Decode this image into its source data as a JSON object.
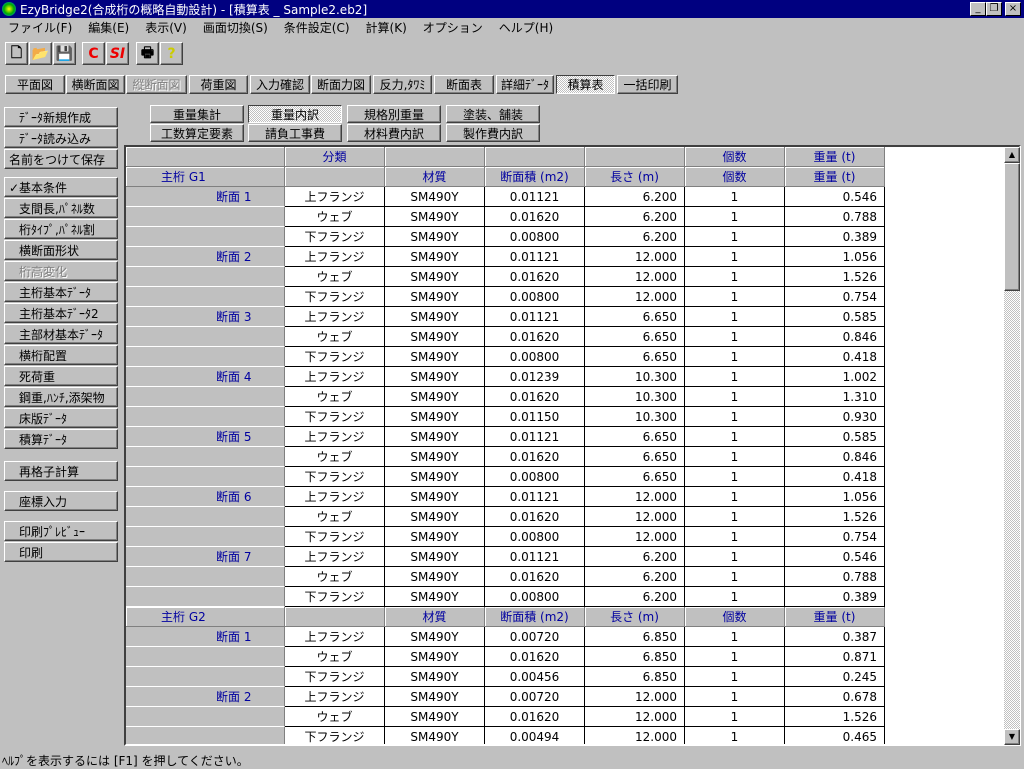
{
  "window": {
    "title": "EzyBridge2(合成桁の概略自動設計) - [積算表 _ Sample2.eb2]",
    "min": "_",
    "max": "❐",
    "close": "×"
  },
  "menu": [
    "ファイル(F)",
    "編集(E)",
    "表示(V)",
    "画面切換(S)",
    "条件設定(C)",
    "計算(K)",
    "オプション",
    "ヘルプ(H)"
  ],
  "toolbar": {
    "new": "🗋",
    "open": "📂",
    "save": "💾",
    "c": "C",
    "si": "SI",
    "print": "🖶",
    "help": "?"
  },
  "tabs": [
    {
      "label": "平面図"
    },
    {
      "label": "横断面図"
    },
    {
      "label": "縦断面図",
      "disabled": true
    },
    {
      "label": "荷重図"
    },
    {
      "label": "入力確認"
    },
    {
      "label": "断面力図"
    },
    {
      "label": "反力,ﾀﾜﾐ"
    },
    {
      "label": "断面表"
    },
    {
      "label": "詳細ﾃﾞｰﾀ"
    },
    {
      "label": "積算表",
      "active": true
    },
    {
      "label": "一括印刷"
    }
  ],
  "sidebar": [
    {
      "label": "ﾃﾞｰﾀ新規作成"
    },
    {
      "label": "ﾃﾞｰﾀ読み込み"
    },
    {
      "label": "名前をつけて保存"
    },
    {
      "label": "✓基本条件"
    },
    {
      "label": "支間長,ﾊﾟﾈﾙ数"
    },
    {
      "label": "桁ﾀｲﾌﾟ,ﾊﾟﾈﾙ割"
    },
    {
      "label": "横断面形状"
    },
    {
      "label": "桁高変化",
      "disabled": true
    },
    {
      "label": "主桁基本ﾃﾞｰﾀ"
    },
    {
      "label": "主桁基本ﾃﾞｰﾀ2"
    },
    {
      "label": "主部材基本ﾃﾞｰﾀ"
    },
    {
      "label": "横桁配置"
    },
    {
      "label": "死荷重"
    },
    {
      "label": "鋼重,ﾊﾝﾁ,添架物"
    },
    {
      "label": "床版ﾃﾞｰﾀ"
    },
    {
      "label": "積算ﾃﾞｰﾀ"
    },
    {
      "label": "再格子計算"
    },
    {
      "label": "座標入力"
    },
    {
      "label": "印刷ﾌﾟﾚﾋﾞｭｰ"
    },
    {
      "label": "印刷"
    }
  ],
  "subtabs": [
    {
      "label": "重量集計"
    },
    {
      "label": "重量内訳",
      "active": true
    },
    {
      "label": "規格別重量"
    },
    {
      "label": "塗装、舗装"
    },
    {
      "label": "工数算定要素"
    },
    {
      "label": "請負工事費"
    },
    {
      "label": "材料費内訳"
    },
    {
      "label": "製作費内訳"
    }
  ],
  "table": {
    "top_header": [
      "分類",
      "",
      "",
      "",
      "個数",
      "重量 (t)"
    ],
    "columns": [
      "材質",
      "断面積 (m2)",
      "長さ (m)",
      "個数",
      "重量 (t)"
    ],
    "groups": [
      {
        "name": "主桁 G1",
        "sections": [
          {
            "name": "断面 1",
            "rows": [
              [
                "上フランジ",
                "SM490Y",
                "0.01121",
                "6.200",
                "1",
                "0.546"
              ],
              [
                "ウェブ",
                "SM490Y",
                "0.01620",
                "6.200",
                "1",
                "0.788"
              ],
              [
                "下フランジ",
                "SM490Y",
                "0.00800",
                "6.200",
                "1",
                "0.389"
              ]
            ]
          },
          {
            "name": "断面 2",
            "rows": [
              [
                "上フランジ",
                "SM490Y",
                "0.01121",
                "12.000",
                "1",
                "1.056"
              ],
              [
                "ウェブ",
                "SM490Y",
                "0.01620",
                "12.000",
                "1",
                "1.526"
              ],
              [
                "下フランジ",
                "SM490Y",
                "0.00800",
                "12.000",
                "1",
                "0.754"
              ]
            ]
          },
          {
            "name": "断面 3",
            "rows": [
              [
                "上フランジ",
                "SM490Y",
                "0.01121",
                "6.650",
                "1",
                "0.585"
              ],
              [
                "ウェブ",
                "SM490Y",
                "0.01620",
                "6.650",
                "1",
                "0.846"
              ],
              [
                "下フランジ",
                "SM490Y",
                "0.00800",
                "6.650",
                "1",
                "0.418"
              ]
            ]
          },
          {
            "name": "断面 4",
            "rows": [
              [
                "上フランジ",
                "SM490Y",
                "0.01239",
                "10.300",
                "1",
                "1.002"
              ],
              [
                "ウェブ",
                "SM490Y",
                "0.01620",
                "10.300",
                "1",
                "1.310"
              ],
              [
                "下フランジ",
                "SM490Y",
                "0.01150",
                "10.300",
                "1",
                "0.930"
              ]
            ]
          },
          {
            "name": "断面 5",
            "rows": [
              [
                "上フランジ",
                "SM490Y",
                "0.01121",
                "6.650",
                "1",
                "0.585"
              ],
              [
                "ウェブ",
                "SM490Y",
                "0.01620",
                "6.650",
                "1",
                "0.846"
              ],
              [
                "下フランジ",
                "SM490Y",
                "0.00800",
                "6.650",
                "1",
                "0.418"
              ]
            ]
          },
          {
            "name": "断面 6",
            "rows": [
              [
                "上フランジ",
                "SM490Y",
                "0.01121",
                "12.000",
                "1",
                "1.056"
              ],
              [
                "ウェブ",
                "SM490Y",
                "0.01620",
                "12.000",
                "1",
                "1.526"
              ],
              [
                "下フランジ",
                "SM490Y",
                "0.00800",
                "12.000",
                "1",
                "0.754"
              ]
            ]
          },
          {
            "name": "断面 7",
            "rows": [
              [
                "上フランジ",
                "SM490Y",
                "0.01121",
                "6.200",
                "1",
                "0.546"
              ],
              [
                "ウェブ",
                "SM490Y",
                "0.01620",
                "6.200",
                "1",
                "0.788"
              ],
              [
                "下フランジ",
                "SM490Y",
                "0.00800",
                "6.200",
                "1",
                "0.389"
              ]
            ]
          }
        ]
      },
      {
        "name": "主桁 G2",
        "sections": [
          {
            "name": "断面 1",
            "rows": [
              [
                "上フランジ",
                "SM490Y",
                "0.00720",
                "6.850",
                "1",
                "0.387"
              ],
              [
                "ウェブ",
                "SM490Y",
                "0.01620",
                "6.850",
                "1",
                "0.871"
              ],
              [
                "下フランジ",
                "SM490Y",
                "0.00456",
                "6.850",
                "1",
                "0.245"
              ]
            ]
          },
          {
            "name": "断面 2",
            "rows": [
              [
                "上フランジ",
                "SM490Y",
                "0.00720",
                "12.000",
                "1",
                "0.678"
              ],
              [
                "ウェブ",
                "SM490Y",
                "0.01620",
                "12.000",
                "1",
                "1.526"
              ],
              [
                "下フランジ",
                "SM490Y",
                "0.00494",
                "12.000",
                "1",
                "0.465"
              ]
            ]
          }
        ]
      }
    ]
  },
  "scroll": {
    "up": "▲",
    "down": "▼"
  },
  "status": "ﾍﾙﾌﾟを表示するには [F1] を押してください。"
}
